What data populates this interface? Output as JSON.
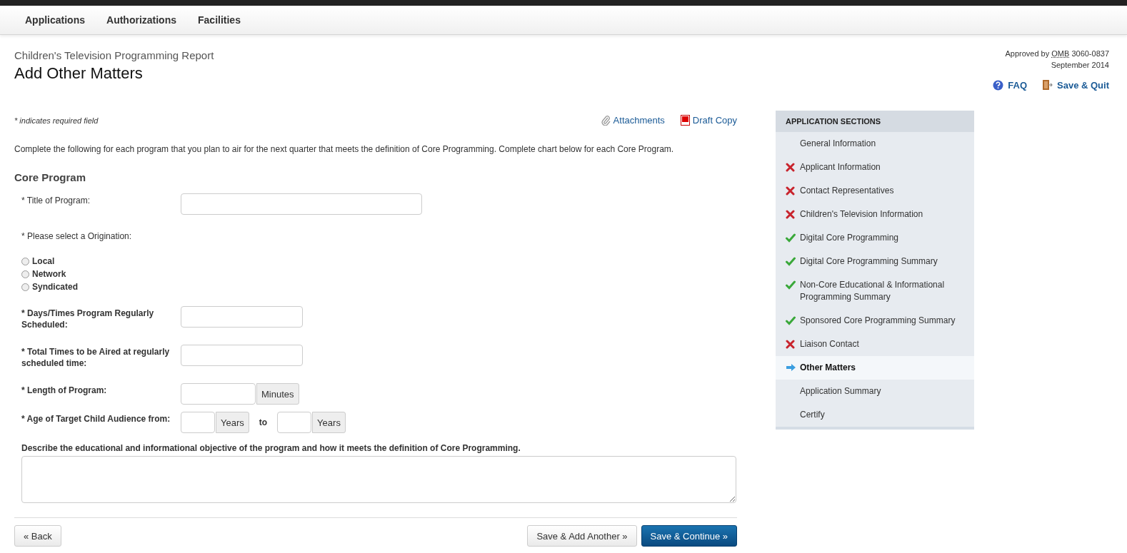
{
  "nav": {
    "items": [
      {
        "label": "Applications"
      },
      {
        "label": "Authorizations"
      },
      {
        "label": "Facilities"
      }
    ]
  },
  "header": {
    "subtitle": "Children's Television Programming Report",
    "title": "Add Other Matters",
    "approval": {
      "prefix": "Approved by",
      "abbr": "OMB",
      "number": "3060-0837",
      "date": "September 2014"
    },
    "links": [
      {
        "kind": "help",
        "label": "FAQ"
      },
      {
        "kind": "exit",
        "label": "Save & Quit"
      }
    ]
  },
  "form": {
    "required_note": "* indicates required field",
    "tools": [
      {
        "kind": "attach",
        "label": "Attachments"
      },
      {
        "kind": "pdf",
        "label": "Draft Copy"
      }
    ],
    "intro": "Complete the following for each program that you plan to air for the next quarter that meets the definition of Core Programming. Complete chart below for each Core Program.",
    "section_title": "Core Program",
    "fields": [
      {
        "kind": "wide-text",
        "label": "* Title of Program:",
        "emphasis": false
      },
      {
        "kind": "radio-group",
        "label": "* Please select a Origination:",
        "emphasis": false,
        "options": [
          {
            "label": "Local",
            "selected": false
          },
          {
            "label": "Network",
            "selected": false
          },
          {
            "label": "Syndicated",
            "selected": false
          }
        ]
      },
      {
        "kind": "text",
        "label": "* Days/Times Program Regularly Scheduled:",
        "emphasis": true
      },
      {
        "kind": "text",
        "label": "* Total Times to be Aired at regularly scheduled time:",
        "emphasis": true
      },
      {
        "kind": "addon",
        "label": "* Length of Program:",
        "emphasis": true,
        "addon": "Minutes"
      },
      {
        "kind": "range",
        "label": "* Age of Target Child Audience from:",
        "emphasis": true,
        "addon": "Years",
        "separator": "to",
        "addon_end": "Years"
      },
      {
        "kind": "textarea",
        "label": "Describe the educational and informational objective of the program and how it meets the definition of Core Programming.",
        "emphasis": true
      }
    ],
    "buttons": [
      {
        "kind": "back",
        "label": "« Back"
      },
      {
        "kind": "secondary",
        "label": "Save & Add Another »"
      },
      {
        "kind": "primary",
        "label": "Save & Continue »"
      }
    ]
  },
  "sidebar": {
    "title": "APPLICATION SECTIONS",
    "items": [
      {
        "label": "General Information",
        "kind": "plain",
        "selected": false
      },
      {
        "label": "Applicant Information",
        "kind": "incomplete",
        "selected": false
      },
      {
        "label": "Contact Representatives",
        "kind": "incomplete",
        "selected": false
      },
      {
        "label": "Children's Television Information",
        "kind": "incomplete",
        "selected": false
      },
      {
        "label": "Digital Core Programming",
        "kind": "complete",
        "selected": false
      },
      {
        "label": "Digital Core Programming Summary",
        "kind": "complete",
        "selected": false
      },
      {
        "label": "Non-Core Educational & Informational Programming Summary",
        "kind": "complete",
        "selected": false
      },
      {
        "label": "Sponsored Core Programming Summary",
        "kind": "complete",
        "selected": false
      },
      {
        "label": "Liaison Contact",
        "kind": "incomplete",
        "selected": false
      },
      {
        "label": "Other Matters",
        "kind": "current",
        "selected": true
      },
      {
        "label": "Application Summary",
        "kind": "plain",
        "selected": false
      },
      {
        "label": "Certify",
        "kind": "plain",
        "selected": false
      }
    ]
  }
}
